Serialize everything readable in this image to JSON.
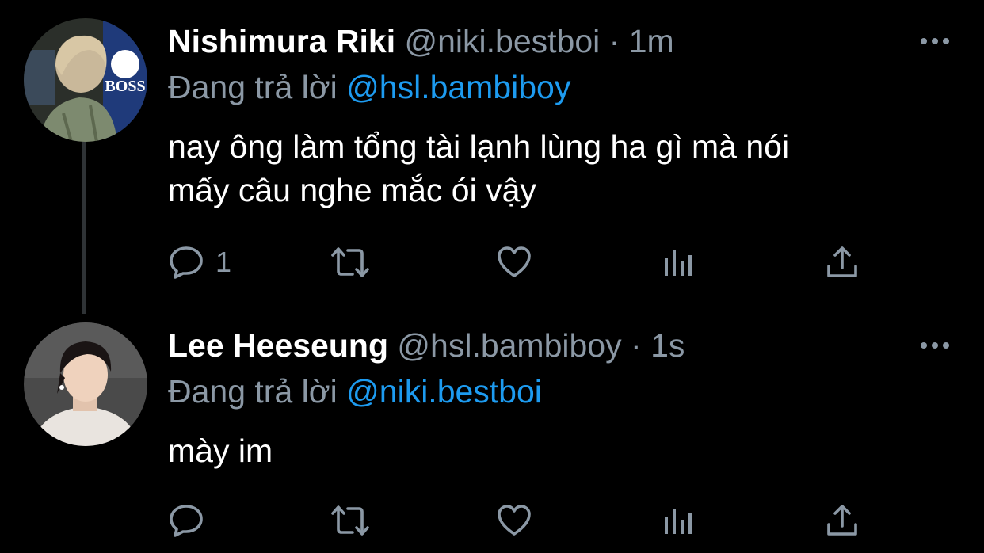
{
  "tweets": [
    {
      "name": "Nishimura Riki",
      "handle": "@niki.bestboi",
      "separator": "·",
      "time": "1m",
      "reply_label": "Đang trả lời",
      "reply_mention": "@hsl.bambiboy",
      "text_line1": "nay ông làm tổng tài lạnh lùng ha gì mà nói",
      "text_line2": "mấy câu nghe mắc ói vậy",
      "reply_count": "1"
    },
    {
      "name": "Lee Heeseung",
      "handle": "@hsl.bambiboy",
      "separator": "·",
      "time": "1s",
      "reply_label": "Đang trả lời",
      "reply_mention": "@niki.bestboi",
      "text_line1": "mày im",
      "reply_count": ""
    }
  ],
  "icons": {
    "more": "more-horizontal-icon",
    "reply": "reply-bubble-icon",
    "retweet": "retweet-icon",
    "like": "heart-icon",
    "views": "bar-chart-icon",
    "share": "share-upload-icon"
  },
  "colors": {
    "background": "#000000",
    "secondary_text": "#8b98a5",
    "accent": "#1d9bf0",
    "thread_line": "#2f3336"
  }
}
